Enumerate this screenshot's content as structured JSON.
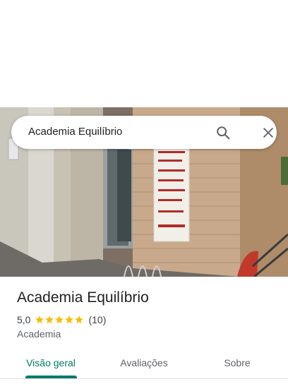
{
  "search": {
    "query": "Academia Equilíbrio"
  },
  "place": {
    "name": "Academia Equilíbrio",
    "rating": "5,0",
    "stars": 5,
    "review_count": "(10)",
    "category": "Academia"
  },
  "tabs": [
    {
      "label": "Visão geral",
      "active": true
    },
    {
      "label": "Avaliações",
      "active": false
    },
    {
      "label": "Sobre",
      "active": false
    }
  ],
  "colors": {
    "accent": "#00796b",
    "star": "#fbbc04"
  },
  "icons": {
    "search": "search-icon",
    "close": "close-icon",
    "star": "star-icon"
  }
}
